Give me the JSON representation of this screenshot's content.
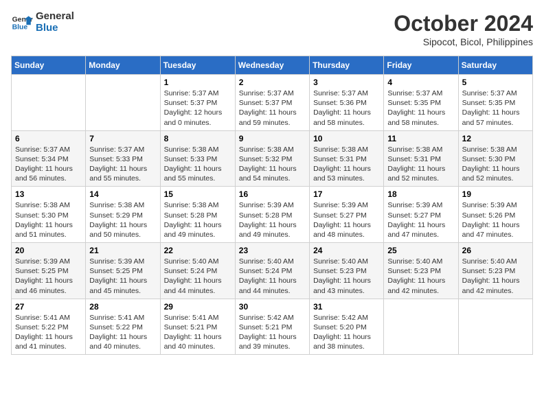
{
  "logo": {
    "line1": "General",
    "line2": "Blue"
  },
  "title": "October 2024",
  "subtitle": "Sipocot, Bicol, Philippines",
  "weekdays": [
    "Sunday",
    "Monday",
    "Tuesday",
    "Wednesday",
    "Thursday",
    "Friday",
    "Saturday"
  ],
  "weeks": [
    [
      {
        "day": "",
        "info": ""
      },
      {
        "day": "",
        "info": ""
      },
      {
        "day": "1",
        "info": "Sunrise: 5:37 AM\nSunset: 5:37 PM\nDaylight: 12 hours\nand 0 minutes."
      },
      {
        "day": "2",
        "info": "Sunrise: 5:37 AM\nSunset: 5:37 PM\nDaylight: 11 hours\nand 59 minutes."
      },
      {
        "day": "3",
        "info": "Sunrise: 5:37 AM\nSunset: 5:36 PM\nDaylight: 11 hours\nand 58 minutes."
      },
      {
        "day": "4",
        "info": "Sunrise: 5:37 AM\nSunset: 5:35 PM\nDaylight: 11 hours\nand 58 minutes."
      },
      {
        "day": "5",
        "info": "Sunrise: 5:37 AM\nSunset: 5:35 PM\nDaylight: 11 hours\nand 57 minutes."
      }
    ],
    [
      {
        "day": "6",
        "info": "Sunrise: 5:37 AM\nSunset: 5:34 PM\nDaylight: 11 hours\nand 56 minutes."
      },
      {
        "day": "7",
        "info": "Sunrise: 5:37 AM\nSunset: 5:33 PM\nDaylight: 11 hours\nand 55 minutes."
      },
      {
        "day": "8",
        "info": "Sunrise: 5:38 AM\nSunset: 5:33 PM\nDaylight: 11 hours\nand 55 minutes."
      },
      {
        "day": "9",
        "info": "Sunrise: 5:38 AM\nSunset: 5:32 PM\nDaylight: 11 hours\nand 54 minutes."
      },
      {
        "day": "10",
        "info": "Sunrise: 5:38 AM\nSunset: 5:31 PM\nDaylight: 11 hours\nand 53 minutes."
      },
      {
        "day": "11",
        "info": "Sunrise: 5:38 AM\nSunset: 5:31 PM\nDaylight: 11 hours\nand 52 minutes."
      },
      {
        "day": "12",
        "info": "Sunrise: 5:38 AM\nSunset: 5:30 PM\nDaylight: 11 hours\nand 52 minutes."
      }
    ],
    [
      {
        "day": "13",
        "info": "Sunrise: 5:38 AM\nSunset: 5:30 PM\nDaylight: 11 hours\nand 51 minutes."
      },
      {
        "day": "14",
        "info": "Sunrise: 5:38 AM\nSunset: 5:29 PM\nDaylight: 11 hours\nand 50 minutes."
      },
      {
        "day": "15",
        "info": "Sunrise: 5:38 AM\nSunset: 5:28 PM\nDaylight: 11 hours\nand 49 minutes."
      },
      {
        "day": "16",
        "info": "Sunrise: 5:39 AM\nSunset: 5:28 PM\nDaylight: 11 hours\nand 49 minutes."
      },
      {
        "day": "17",
        "info": "Sunrise: 5:39 AM\nSunset: 5:27 PM\nDaylight: 11 hours\nand 48 minutes."
      },
      {
        "day": "18",
        "info": "Sunrise: 5:39 AM\nSunset: 5:27 PM\nDaylight: 11 hours\nand 47 minutes."
      },
      {
        "day": "19",
        "info": "Sunrise: 5:39 AM\nSunset: 5:26 PM\nDaylight: 11 hours\nand 47 minutes."
      }
    ],
    [
      {
        "day": "20",
        "info": "Sunrise: 5:39 AM\nSunset: 5:25 PM\nDaylight: 11 hours\nand 46 minutes."
      },
      {
        "day": "21",
        "info": "Sunrise: 5:39 AM\nSunset: 5:25 PM\nDaylight: 11 hours\nand 45 minutes."
      },
      {
        "day": "22",
        "info": "Sunrise: 5:40 AM\nSunset: 5:24 PM\nDaylight: 11 hours\nand 44 minutes."
      },
      {
        "day": "23",
        "info": "Sunrise: 5:40 AM\nSunset: 5:24 PM\nDaylight: 11 hours\nand 44 minutes."
      },
      {
        "day": "24",
        "info": "Sunrise: 5:40 AM\nSunset: 5:23 PM\nDaylight: 11 hours\nand 43 minutes."
      },
      {
        "day": "25",
        "info": "Sunrise: 5:40 AM\nSunset: 5:23 PM\nDaylight: 11 hours\nand 42 minutes."
      },
      {
        "day": "26",
        "info": "Sunrise: 5:40 AM\nSunset: 5:23 PM\nDaylight: 11 hours\nand 42 minutes."
      }
    ],
    [
      {
        "day": "27",
        "info": "Sunrise: 5:41 AM\nSunset: 5:22 PM\nDaylight: 11 hours\nand 41 minutes."
      },
      {
        "day": "28",
        "info": "Sunrise: 5:41 AM\nSunset: 5:22 PM\nDaylight: 11 hours\nand 40 minutes."
      },
      {
        "day": "29",
        "info": "Sunrise: 5:41 AM\nSunset: 5:21 PM\nDaylight: 11 hours\nand 40 minutes."
      },
      {
        "day": "30",
        "info": "Sunrise: 5:42 AM\nSunset: 5:21 PM\nDaylight: 11 hours\nand 39 minutes."
      },
      {
        "day": "31",
        "info": "Sunrise: 5:42 AM\nSunset: 5:20 PM\nDaylight: 11 hours\nand 38 minutes."
      },
      {
        "day": "",
        "info": ""
      },
      {
        "day": "",
        "info": ""
      }
    ]
  ]
}
